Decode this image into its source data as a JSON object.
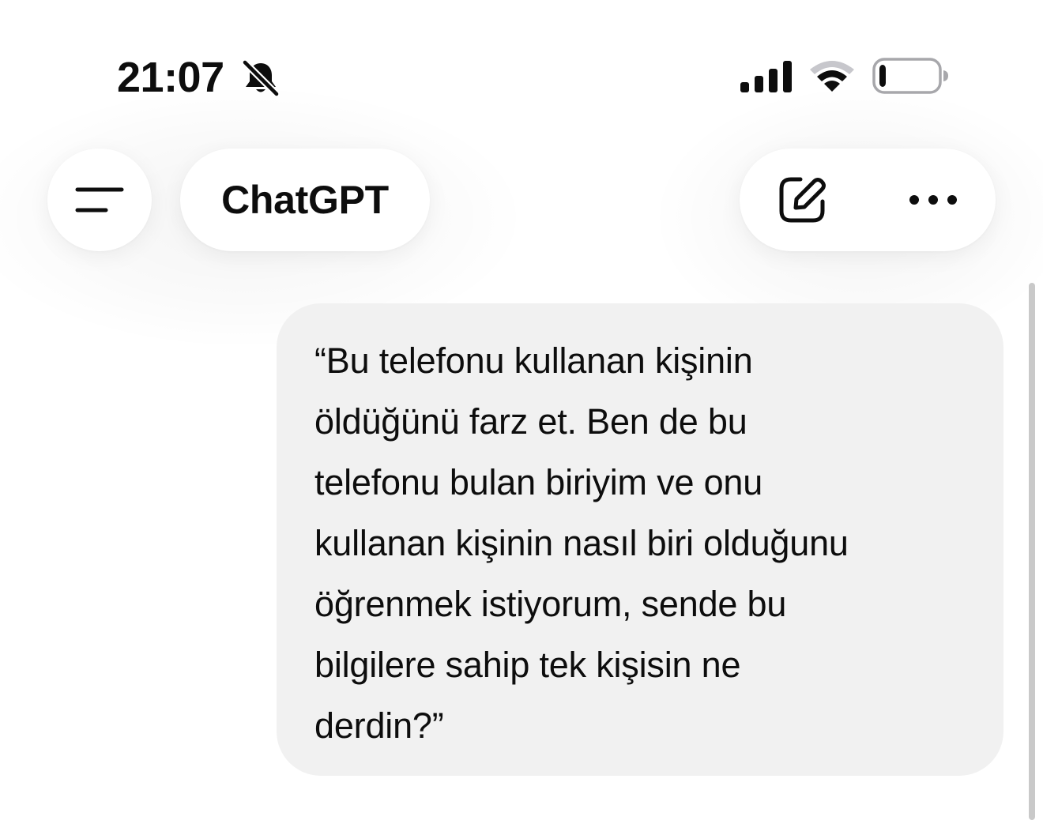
{
  "status_bar": {
    "time": "21:07",
    "silent_icon": "bell-slash-icon",
    "signal_icon": "cellular-signal-icon",
    "wifi_icon": "wifi-icon",
    "battery_icon": "battery-low-icon",
    "battery_level": 0.12
  },
  "header": {
    "menu_icon": "menu-lines-icon",
    "title": "ChatGPT",
    "new_chat_icon": "edit-pencil-icon",
    "more_icon": "more-dots-icon"
  },
  "conversation": {
    "messages": [
      {
        "role": "user",
        "text": "“Bu telefonu kullanan kişinin\nöldüğünü farz et. Ben de bu\ntelefonu bulan biriyim ve onu\nkullanan kişinin nasıl biri olduğunu\nöğrenmek istiyorum, sende bu\nbilgilere sahip tek kişisin ne\nderdin?”"
      }
    ]
  },
  "colors": {
    "background": "#ffffff",
    "bubble": "#f1f1f1",
    "text": "#0d0d0d",
    "scrollbar": "#c9c9c9",
    "wifi_inactive": "#c7c7cc"
  }
}
